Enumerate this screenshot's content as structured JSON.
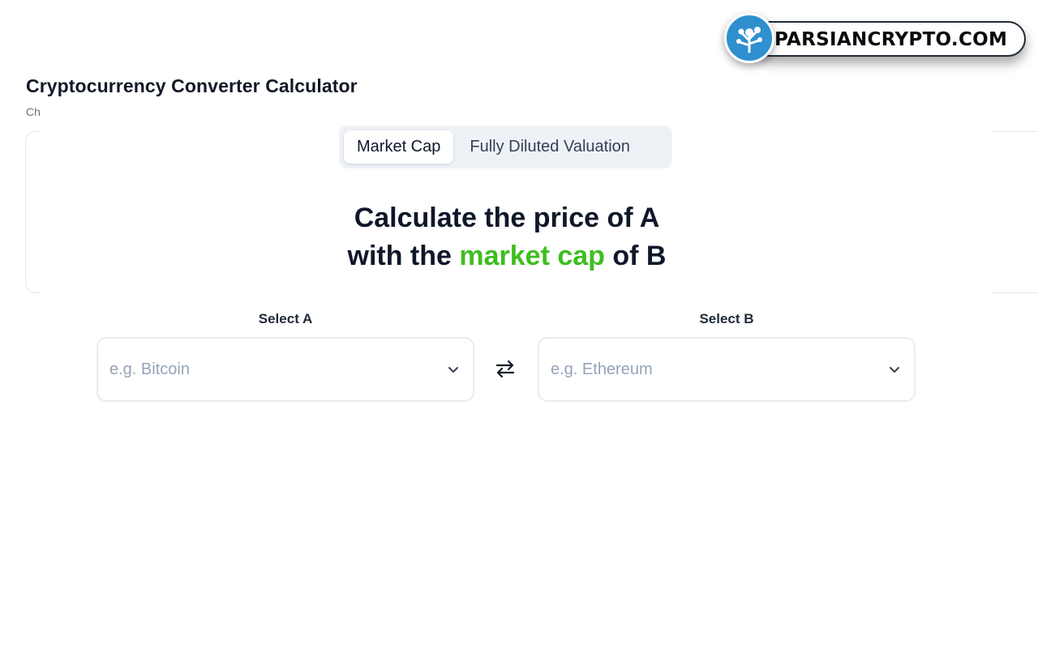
{
  "header": {
    "title": "Cryptocurrency Converter Calculator",
    "subtitle": "Ch"
  },
  "tabs": [
    {
      "label": "Market Cap",
      "active": true
    },
    {
      "label": "Fully Diluted Valuation",
      "active": false
    }
  ],
  "headline": {
    "line1": "Calculate the price of A",
    "line2_pre": "with the ",
    "line2_accent": "market cap",
    "line2_post": " of B",
    "accent_color": "#3ebe1f"
  },
  "select_a": {
    "label": "Select A",
    "placeholder": "e.g. Bitcoin",
    "icon": "chevron-down-icon"
  },
  "select_b": {
    "label": "Select B",
    "placeholder": "e.g. Ethereum",
    "icon": "chevron-down-icon"
  },
  "swap": {
    "icon": "swap-arrows-icon"
  },
  "watermark": {
    "text": "PARSIANCRYPTO.COM",
    "icon": "tree-logo-icon",
    "color": "#2f8fcf"
  }
}
